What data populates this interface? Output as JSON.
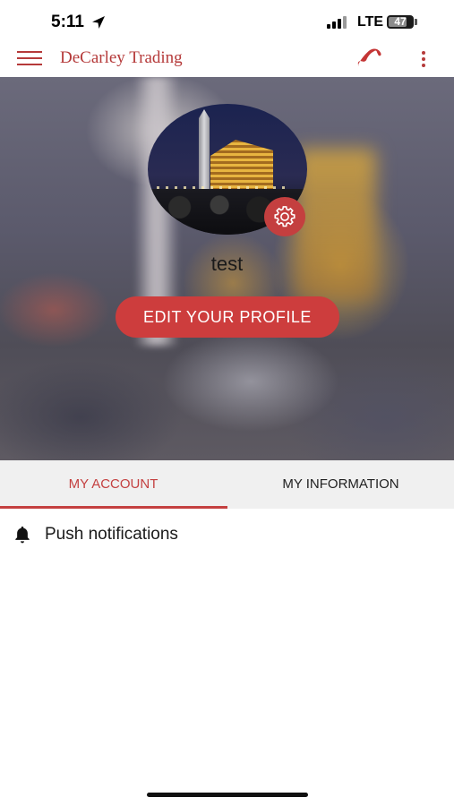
{
  "status_bar": {
    "time": "5:11",
    "network": "LTE",
    "battery": "47"
  },
  "app_bar": {
    "title": "DeCarley Trading"
  },
  "profile": {
    "name": "test",
    "edit_label": "EDIT YOUR PROFILE"
  },
  "tabs": [
    {
      "label": "MY ACCOUNT",
      "active": true
    },
    {
      "label": "MY INFORMATION",
      "active": false
    }
  ],
  "settings": {
    "push_label": "Push notifications"
  },
  "colors": {
    "brand": "#c44040",
    "button": "#cd3d3d",
    "tab_bg": "#f0f0f0"
  },
  "icons": [
    "location-arrow-icon",
    "signal-icon",
    "battery-icon",
    "hamburger-menu-icon",
    "phone-icon",
    "more-vertical-icon",
    "gear-icon",
    "bell-icon"
  ]
}
